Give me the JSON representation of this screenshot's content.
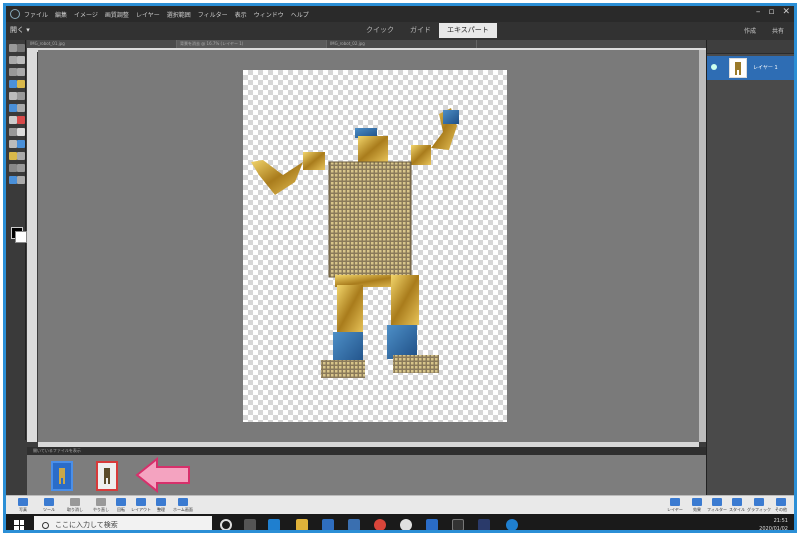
{
  "app": {
    "menus": [
      "ファイル",
      "編集",
      "イメージ",
      "画質調整",
      "レイヤー",
      "選択範囲",
      "フィルター",
      "表示",
      "ウィンドウ",
      "ヘルプ"
    ],
    "open_label": "開く",
    "mode_tabs": [
      {
        "label": "クイック",
        "active": false
      },
      {
        "label": "ガイド",
        "active": false
      },
      {
        "label": "エキスパート",
        "active": true
      }
    ],
    "right_menus": [
      "作成",
      "共有"
    ]
  },
  "document_tabs": [
    {
      "label": "IMG_robot_01.jpg",
      "active": false
    },
    {
      "label": "背景を消去 @ 16.7% (レイヤー 1)",
      "active": true
    },
    {
      "label": "IMG_robot_02.jpg",
      "active": false
    }
  ],
  "layers": {
    "items": [
      {
        "name": "レイヤー 1",
        "visible": true,
        "selected": true
      }
    ]
  },
  "photo_bin": {
    "header_label": "開いているファイルを表示",
    "thumbnails": [
      {
        "name": "thumb-1",
        "selected": true
      },
      {
        "name": "thumb-2",
        "highlighted": true
      }
    ]
  },
  "action_bar": {
    "left": [
      "写真",
      "ツール",
      "取り消し",
      "やり直し",
      "回転",
      "レイアウト",
      "整理",
      "ホーム画面"
    ],
    "right": [
      "レイヤー",
      "効果",
      "フィルター",
      "スタイル",
      "グラフィック",
      "その他"
    ]
  },
  "taskbar": {
    "search_placeholder": "ここに入力して検索",
    "time": "21:51",
    "date": "2020/01/02"
  },
  "colors": {
    "frame": "#2b8fd6",
    "canvas_bg": "#7a7a7a",
    "selected_layer": "#2e6db4",
    "arrow": "#f4a3c0",
    "arrow_border": "#d7306b"
  }
}
